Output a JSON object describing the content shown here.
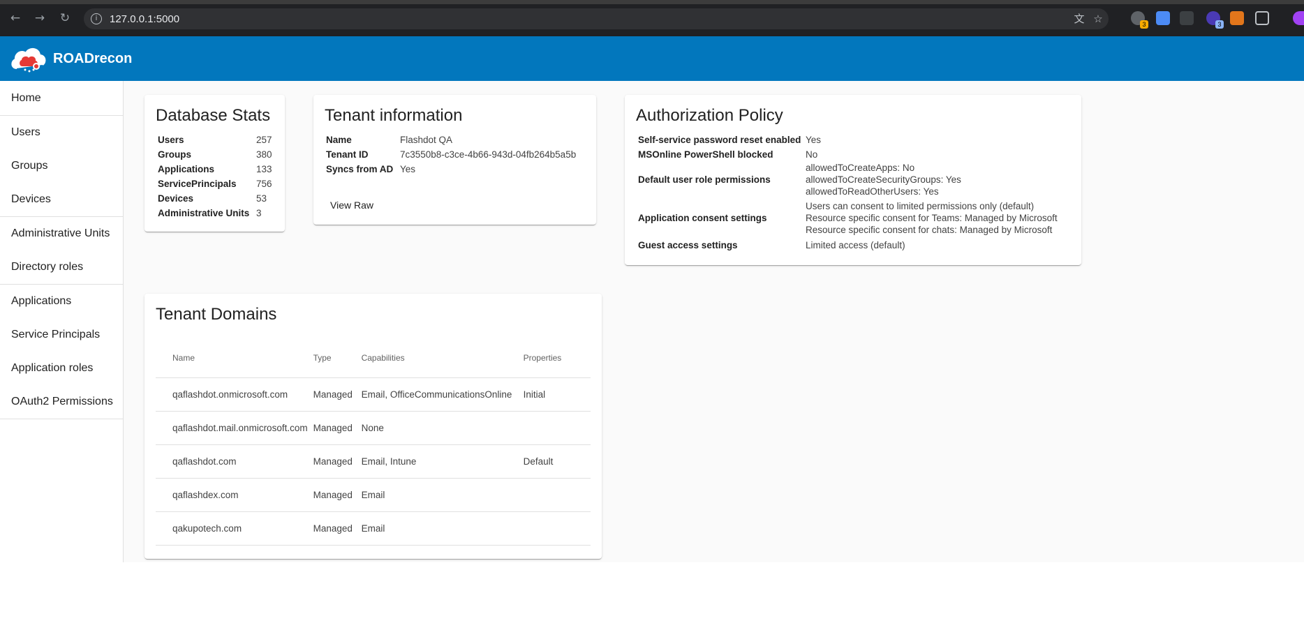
{
  "browser": {
    "url": "127.0.0.1:5000",
    "ext_badge_1": "3",
    "ext_badge_2": "3"
  },
  "app": {
    "title": "ROADrecon"
  },
  "sidebar": {
    "items": [
      {
        "label": "Home"
      },
      {
        "label": "Users"
      },
      {
        "label": "Groups"
      },
      {
        "label": "Devices"
      },
      {
        "label": "Administrative Units"
      },
      {
        "label": "Directory roles"
      },
      {
        "label": "Applications"
      },
      {
        "label": "Service Principals"
      },
      {
        "label": "Application roles"
      },
      {
        "label": "OAuth2 Permissions"
      }
    ]
  },
  "database_stats": {
    "title": "Database Stats",
    "rows": [
      {
        "label": "Users",
        "value": "257"
      },
      {
        "label": "Groups",
        "value": "380"
      },
      {
        "label": "Applications",
        "value": "133"
      },
      {
        "label": "ServicePrincipals",
        "value": "756"
      },
      {
        "label": "Devices",
        "value": "53"
      },
      {
        "label": "Administrative Units",
        "value": "3"
      }
    ]
  },
  "tenant_info": {
    "title": "Tenant information",
    "rows": [
      {
        "label": "Name",
        "value": "Flashdot QA"
      },
      {
        "label": "Tenant ID",
        "value": "7c3550b8-c3ce-4b66-943d-04fb264b5a5b"
      },
      {
        "label": "Syncs from AD",
        "value": "Yes"
      }
    ],
    "view_raw": "View Raw"
  },
  "auth_policy": {
    "title": "Authorization Policy",
    "rows": [
      {
        "label": "Self-service password reset enabled",
        "lines": [
          "Yes"
        ]
      },
      {
        "label": "MSOnline PowerShell blocked",
        "lines": [
          "No"
        ]
      },
      {
        "label": "Default user role permissions",
        "lines": [
          "allowedToCreateApps: No",
          "allowedToCreateSecurityGroups: Yes",
          "allowedToReadOtherUsers: Yes"
        ]
      },
      {
        "label": "Application consent settings",
        "lines": [
          "Users can consent to limited permissions only (default)",
          "Resource specific consent for Teams: Managed by Microsoft",
          "Resource specific consent for chats: Managed by Microsoft"
        ]
      },
      {
        "label": "Guest access settings",
        "lines": [
          "Limited access (default)"
        ]
      }
    ]
  },
  "tenant_domains": {
    "title": "Tenant Domains",
    "columns": [
      "Name",
      "Type",
      "Capabilities",
      "Properties"
    ],
    "rows": [
      {
        "name": "qaflashdot.onmicrosoft.com",
        "type": "Managed",
        "capabilities": "Email, OfficeCommunicationsOnline",
        "properties": "Initial"
      },
      {
        "name": "qaflashdot.mail.onmicrosoft.com",
        "type": "Managed",
        "capabilities": "None",
        "properties": ""
      },
      {
        "name": "qaflashdot.com",
        "type": "Managed",
        "capabilities": "Email, Intune",
        "properties": "Default"
      },
      {
        "name": "qaflashdex.com",
        "type": "Managed",
        "capabilities": "Email",
        "properties": ""
      },
      {
        "name": "qakupotech.com",
        "type": "Managed",
        "capabilities": "Email",
        "properties": ""
      }
    ]
  },
  "colors": {
    "header_blue": "#0277bd",
    "background": "#fafafa"
  }
}
